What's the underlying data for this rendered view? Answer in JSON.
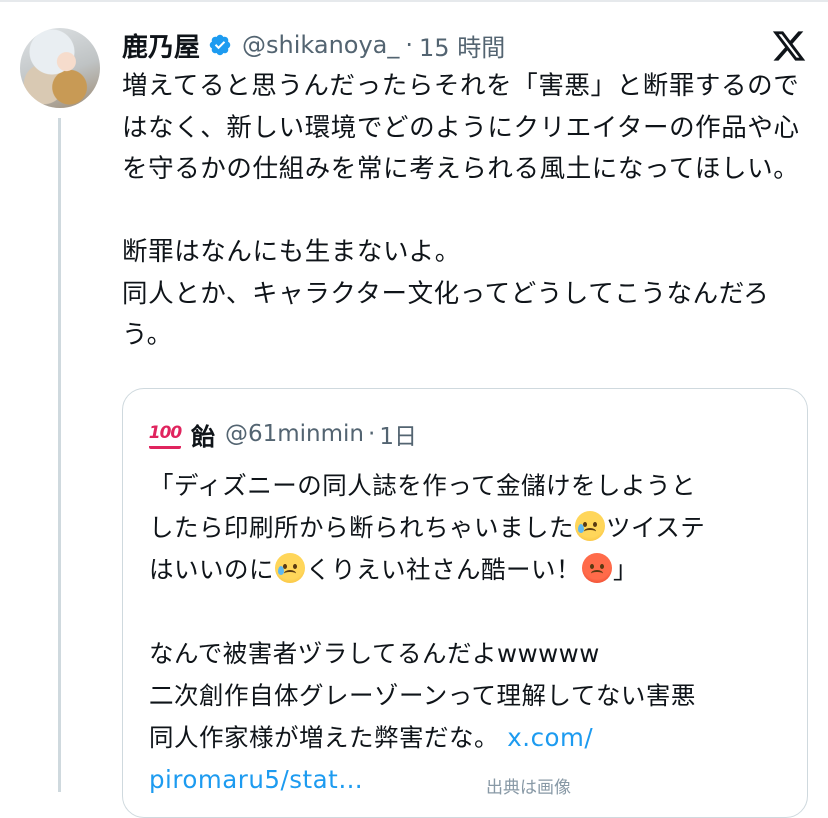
{
  "tweet": {
    "display_name": "鹿乃屋",
    "handle": "@shikanoya_",
    "dot": "·",
    "time": "15 時間",
    "text": "増えてると思うんだったらそれを「害悪」と断罪するのではなく、新しい環境でどのようにクリエイターの作品や心を守るかの仕組みを常に考えられる風土になってほしい。\n\n断罪はなんにも生まないよ。\n同人とか、キャラクター文化ってどうしてこうなんだろう。"
  },
  "icons": {
    "verified": "verified-badge-icon",
    "x_logo": "x-logo-icon",
    "hundred": "hundred-points-emoji",
    "cry": "crying-face-emoji",
    "angry": "angry-face-emoji"
  },
  "colors": {
    "verified": "#1d9bf0",
    "link": "#1d9bf0",
    "secondary_text": "#536471",
    "border": "#cfd9de"
  },
  "quote": {
    "name": "飴",
    "handle": "@61minmin",
    "dot": "·",
    "time": "1日",
    "emoji_hundred_text": "100",
    "line1": "「ディズニーの同人誌を作って金儲けをしようと",
    "line2": "したら印刷所から断られちゃいました",
    "line2b": "ツイステ",
    "line3": "はいいのに",
    "line3b": "くりえい社さん酷ーい！",
    "line3c": "」",
    "line5": "なんで被害者ヅラしてるんだよwwwww",
    "line6": "二次創作自体グレーゾーンって理解してない害悪",
    "line7": "同人作家様が増えた弊害だな。",
    "link_part1": "x.com/",
    "link_part2": "piromaru5/stat…",
    "clipped": "出典は画像"
  }
}
